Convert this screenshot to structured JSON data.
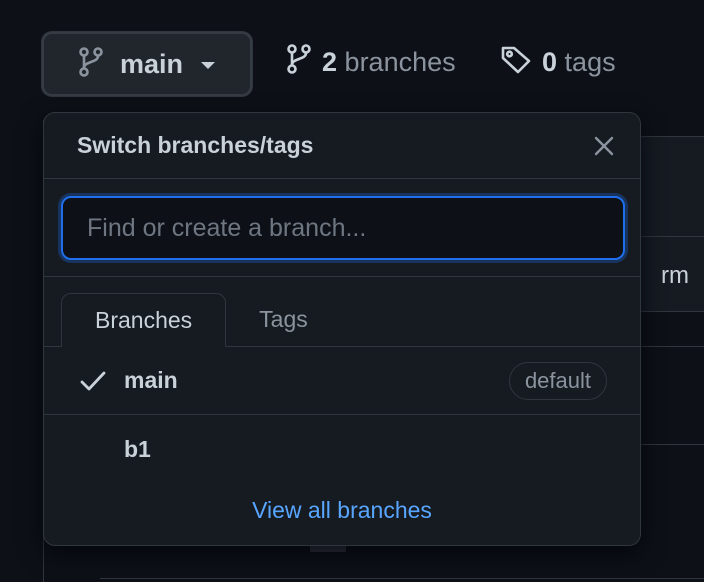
{
  "toolbar": {
    "current_branch": "main",
    "branches_count": "2",
    "branches_label": "branches",
    "tags_count": "0",
    "tags_label": "tags"
  },
  "dropdown": {
    "title": "Switch branches/tags",
    "filter_placeholder": "Find or create a branch...",
    "filter_value": "",
    "tabs": [
      {
        "label": "Branches",
        "active": true
      },
      {
        "label": "Tags",
        "active": false
      }
    ],
    "branches": [
      {
        "name": "main",
        "selected": true,
        "badge": "default"
      },
      {
        "name": "b1",
        "selected": false,
        "badge": ""
      }
    ],
    "view_all_label": "View all branches"
  },
  "background": {
    "partial_text": "rm"
  },
  "colors": {
    "background": "#0d1117",
    "panel": "#161b22",
    "border": "#30363d",
    "link": "#58a6ff",
    "focus": "#1f6feb"
  }
}
